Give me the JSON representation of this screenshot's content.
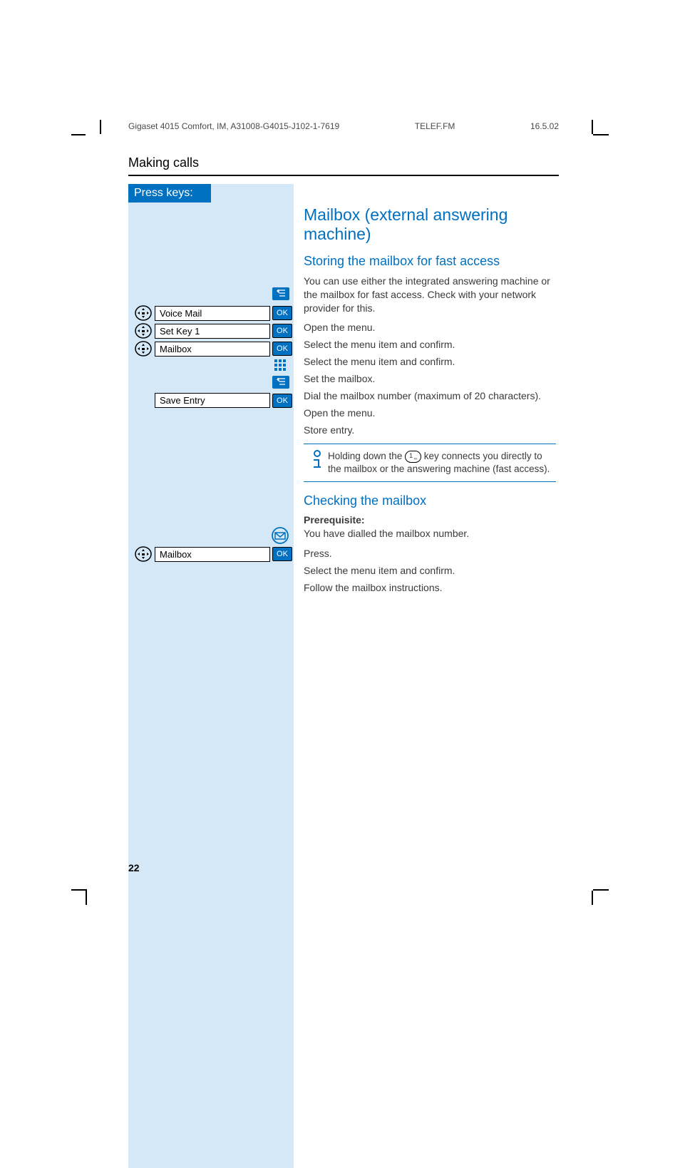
{
  "header": {
    "doc_id": "Gigaset 4015 Comfort, IM, A31008-G4015-J102-1-7619",
    "file": "TELEF.FM",
    "date": "16.5.02"
  },
  "section_title": "Making calls",
  "sidebar": {
    "press_keys_label": "Press keys:",
    "ok_label": "OK",
    "items": {
      "voice_mail": "Voice Mail",
      "set_key_1": "Set Key 1",
      "mailbox": "Mailbox",
      "save_entry": "Save Entry",
      "mailbox2": "Mailbox"
    }
  },
  "main": {
    "h1": "Mailbox (external answering machine)",
    "h2a": "Storing the mailbox for fast access",
    "intro": "You can use either the integrated answering machine or  the mailbox for fast access. Check with your network provider for this.",
    "r1": "Open the menu.",
    "r2": "Select the menu item and confirm.",
    "r3": "Select the menu item and confirm.",
    "r4": "Set the mailbox.",
    "r5": "Dial the mailbox number (maximum of 20 characters).",
    "r6": "Open the menu.",
    "r7": "Store entry.",
    "info_pre": "Holding down the ",
    "info_key": "1",
    "info_post": " key connects you directly to the mailbox or the answering  machine (fast access).",
    "h2b": "Checking the mailbox",
    "prereq_label": "Prerequisite:",
    "prereq_text": "You have dialled the mailbox number.",
    "r8": "Press.",
    "r9": "Select the menu item and confirm.",
    "r10": "Follow the mailbox instructions."
  },
  "page_number": "22"
}
